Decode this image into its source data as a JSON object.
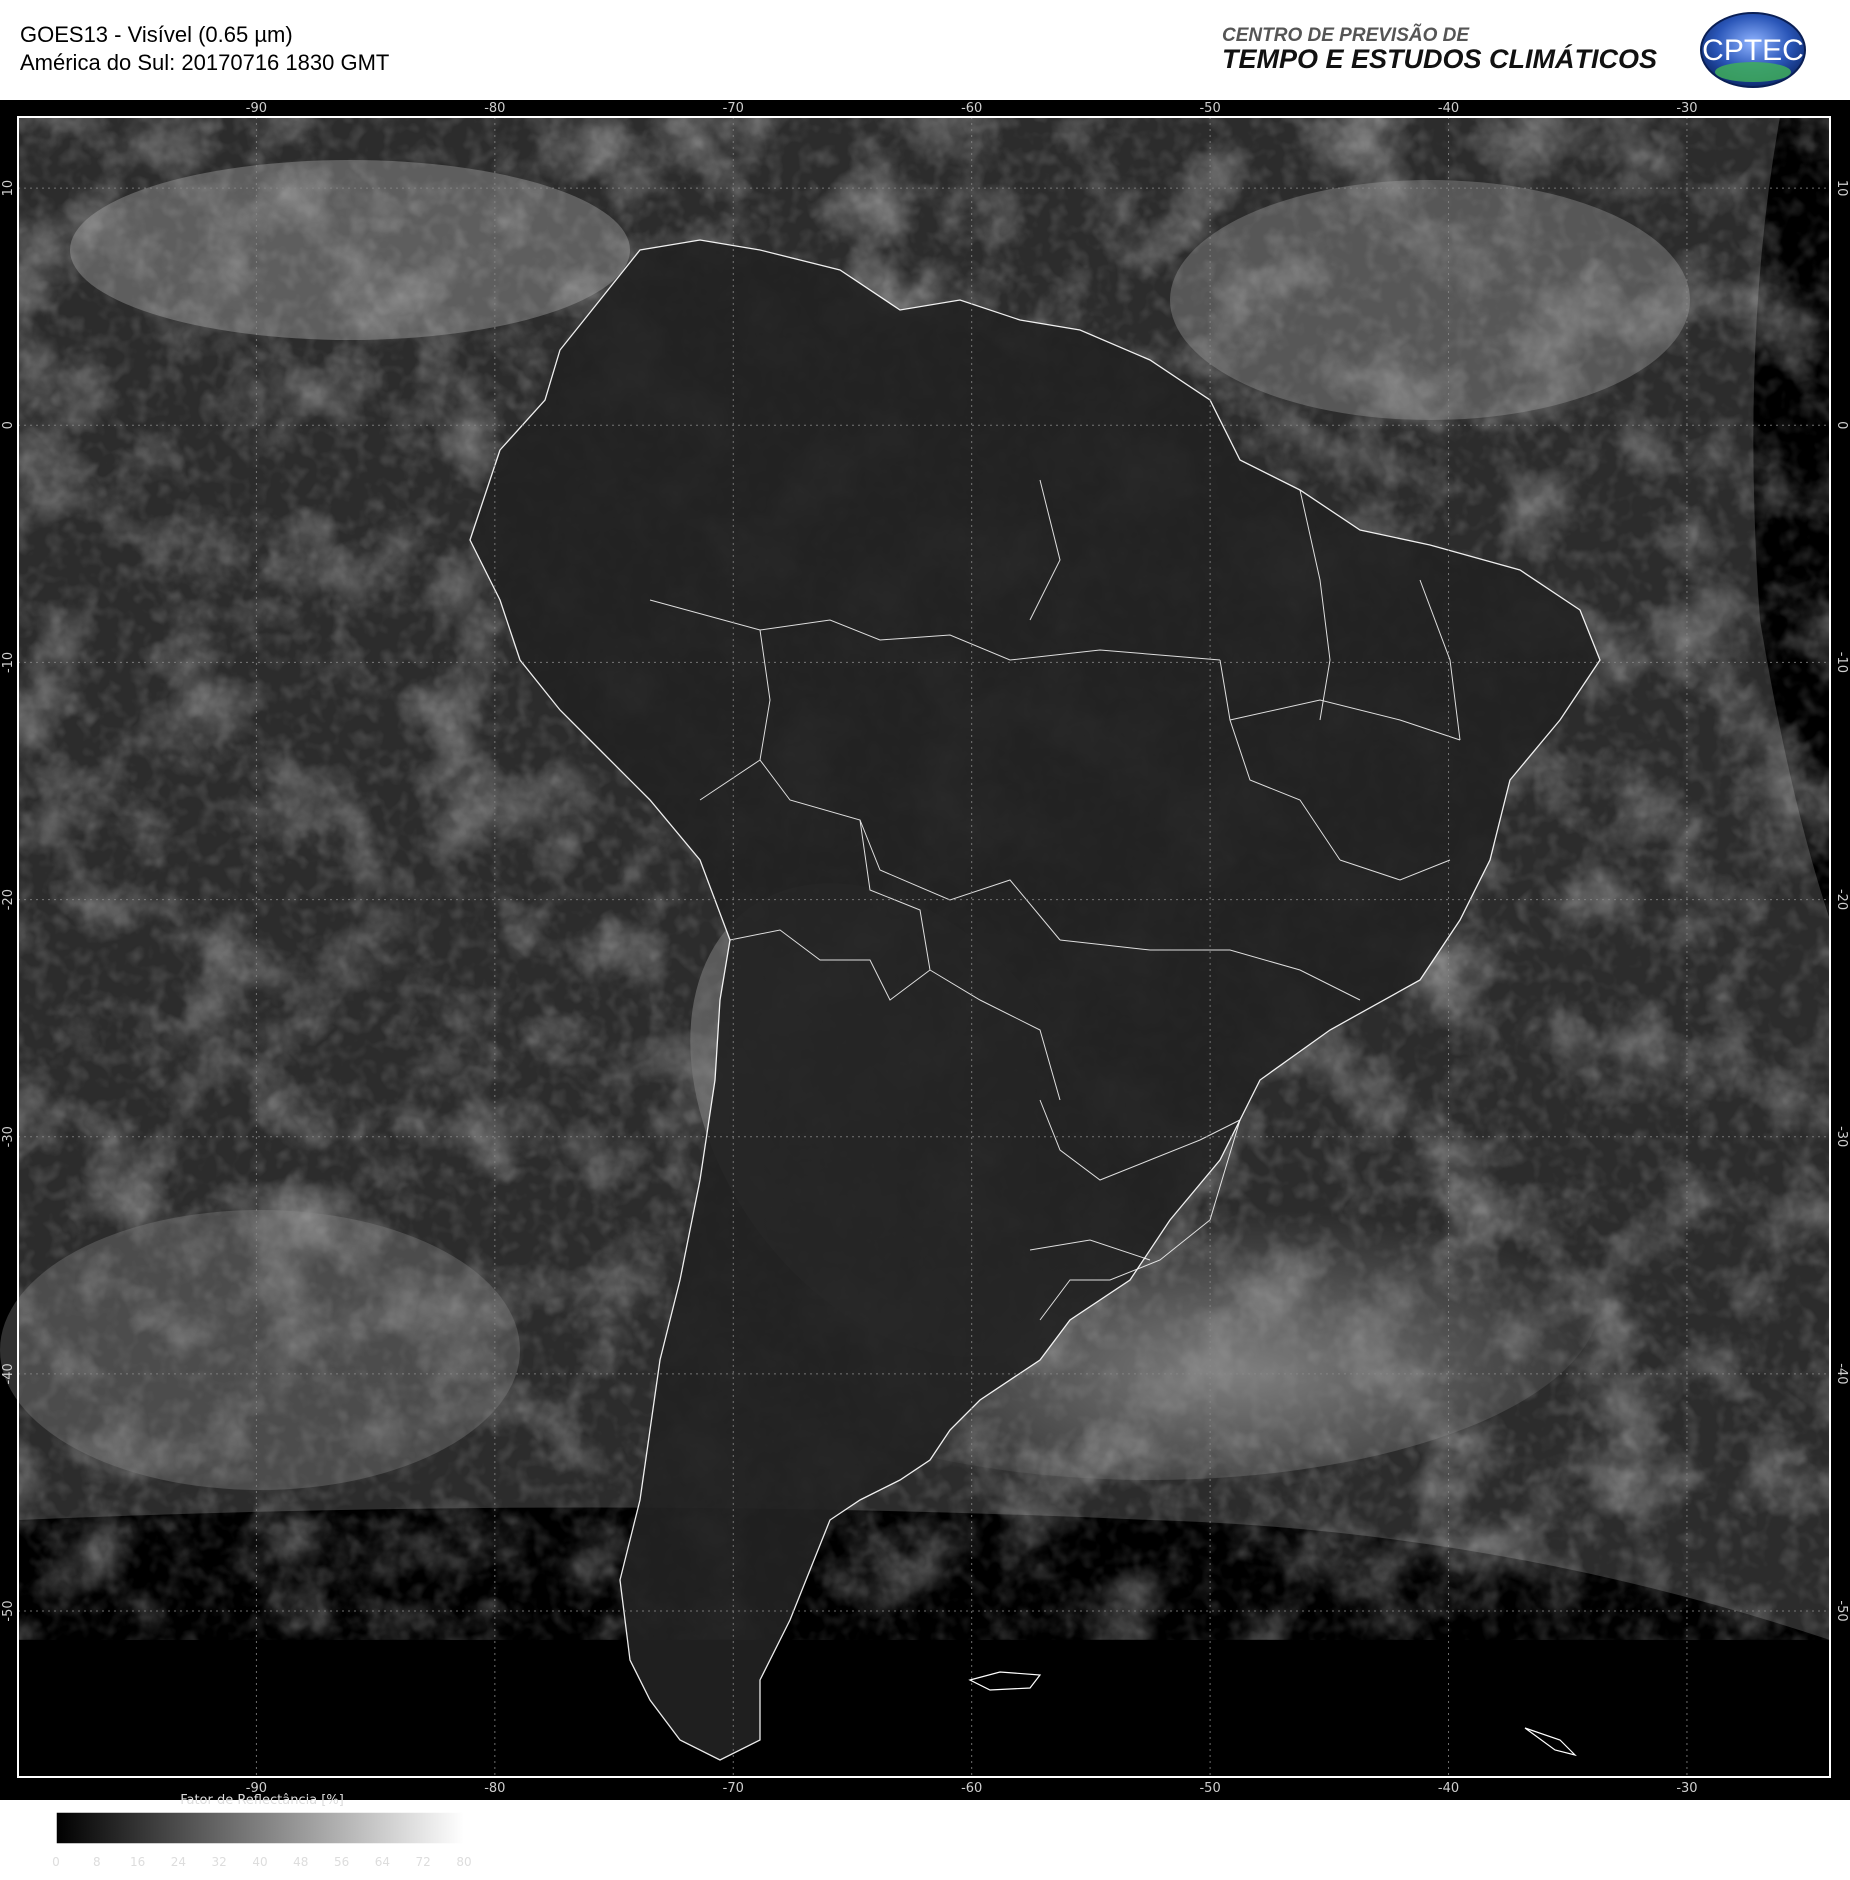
{
  "header": {
    "title_line1": "GOES13 - Visível (0.65 µm)",
    "title_line2": "América do Sul: 20170716 1830 GMT",
    "org_line1": "CENTRO DE PREVISÃO DE",
    "org_line2": "TEMPO E ESTUDOS CLIMÁTICOS",
    "logo_text": "CPTEC"
  },
  "map": {
    "longitude_labels": [
      "-90",
      "-80",
      "-70",
      "-60",
      "-50",
      "-40",
      "-30"
    ],
    "latitude_labels": [
      "10",
      "0",
      "-10",
      "-20",
      "-30",
      "-40",
      "-50"
    ],
    "lon_range": [
      -100,
      -24
    ],
    "lat_range": [
      13,
      -57
    ]
  },
  "colorbar": {
    "title": "Fator de Reflectância [%]",
    "ticks": [
      "0",
      "8",
      "16",
      "24",
      "32",
      "40",
      "48",
      "56",
      "64",
      "72",
      "80"
    ]
  },
  "colors": {
    "background": "#000000",
    "border": "#ffffff",
    "grid": "#8a8a8a",
    "logo_blue": "#1a3d8f"
  }
}
